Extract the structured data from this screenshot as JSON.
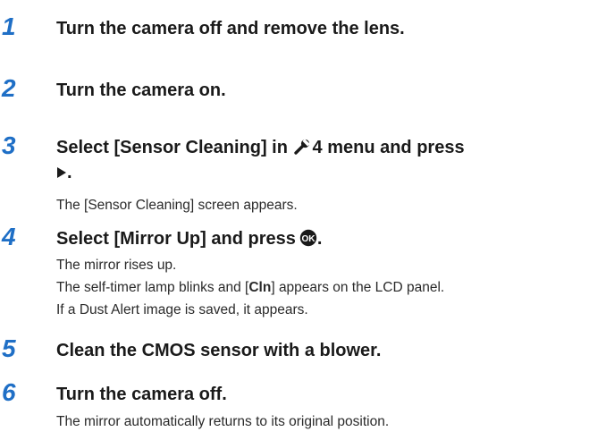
{
  "steps": [
    {
      "number": "1",
      "title": "Turn the camera off and remove the lens."
    },
    {
      "number": "2",
      "title": "Turn the camera on."
    },
    {
      "number": "3",
      "title_before_icon": "Select [Sensor Cleaning] in ",
      "title_after_icon": "4 menu and press",
      "title_end": ".",
      "body": [
        "The [Sensor Cleaning] screen appears."
      ]
    },
    {
      "number": "4",
      "title": "Select [Mirror Up] and press",
      "title_end": ".",
      "body_1": "The mirror rises up.",
      "body_2_before": "The self-timer lamp blinks and [",
      "body_2_code": "Cln",
      "body_2_after": "] appears on the LCD panel.",
      "body_3": "If a Dust Alert image is saved, it appears."
    },
    {
      "number": "5",
      "title": "Clean the CMOS sensor with a blower."
    },
    {
      "number": "6",
      "title": "Turn the camera off.",
      "body": [
        "The mirror automatically returns to its original position."
      ]
    }
  ],
  "icons": {
    "setup_menu": "wrench-icon",
    "right_arrow": "right-triangle-icon",
    "ok_button": "ok-button-icon"
  },
  "colors": {
    "step_number": "#1f6fc6",
    "text": "#1a1a1a"
  }
}
